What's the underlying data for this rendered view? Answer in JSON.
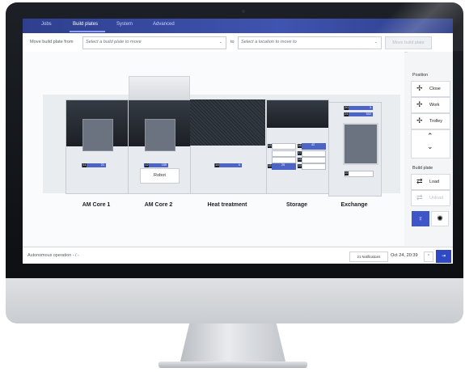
{
  "tabs": {
    "jobs": "Jobs",
    "build_plates": "Build plates",
    "system": "System",
    "advanced": "Advanced"
  },
  "move": {
    "from_label": "Move build plate from",
    "from_placeholder": "Select a build plate to move",
    "to_label": "to",
    "to_placeholder": "Select a location to move to",
    "button": "Move build plate"
  },
  "modules": {
    "am_core_1": {
      "name": "AM Core 1",
      "tag_key": "11",
      "tag_value": "21"
    },
    "am_core_2": {
      "name": "AM Core 2",
      "tag_key": "12",
      "tag_value": "155"
    },
    "heat_treatment": {
      "name": "Heat treatment",
      "tag_key": "14",
      "tag_value": "6"
    },
    "storage": {
      "name": "Storage",
      "slots": [
        {
          "key": "13",
          "value": ""
        },
        {
          "key": "16",
          "value": "42"
        },
        {
          "key": "17",
          "value": ""
        },
        {
          "key": "18",
          "value": ""
        },
        {
          "key": "15",
          "value": "25"
        },
        {
          "key": "19",
          "value": ""
        }
      ]
    },
    "exchange": {
      "name": "Exchange",
      "top_tags": [
        {
          "key": "20",
          "value": "3"
        },
        {
          "key": "21",
          "value": "502"
        }
      ],
      "bottom_tag_key": "22"
    },
    "robot": "Robot"
  },
  "panel": {
    "position_heading": "Position",
    "close": "Close",
    "work": "Work",
    "trolley": "Trolley",
    "build_plate_heading": "Build plate",
    "load": "Load",
    "unload": "Unload"
  },
  "status": {
    "mode": "Autonomous operation",
    "sep": "-  /  -",
    "notifications": "21 Notifications",
    "datetime": "Oct 24,  20:39"
  },
  "colors": {
    "accent": "#3e56c7",
    "tabbar": "#3f54b0"
  }
}
